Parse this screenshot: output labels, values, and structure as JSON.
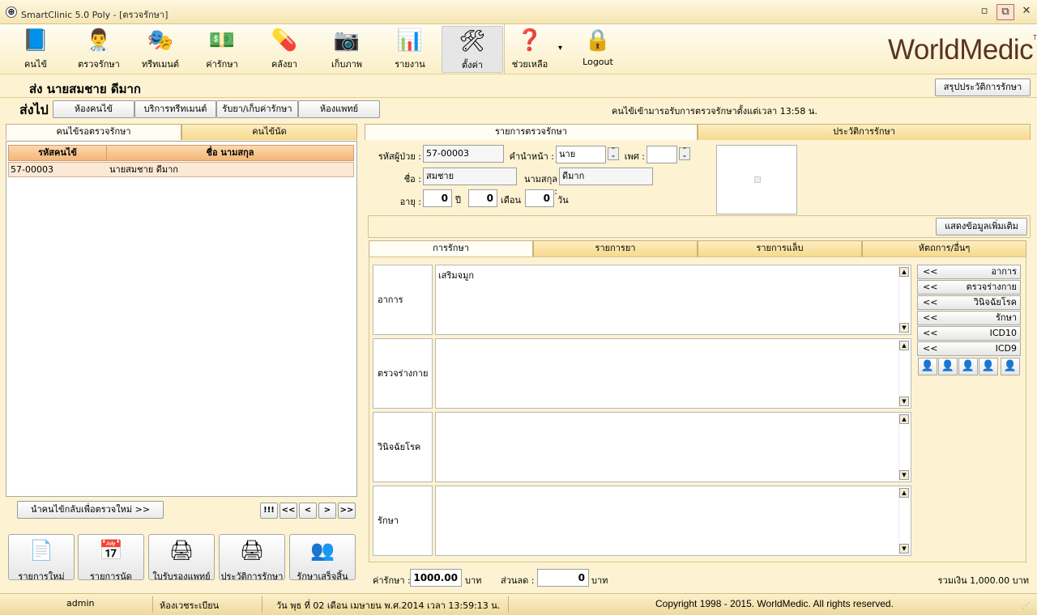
{
  "window": {
    "title": "SmartClinic 5.0 Poly - [ตรวจรักษา]",
    "app_icon": "⊕",
    "minimize_glyph": "▫",
    "restore_glyph": "⧉",
    "close_glyph": "✕"
  },
  "toolbar": {
    "items": [
      {
        "label": "คนไข้",
        "icon": "patient-book-icon",
        "glyph": "📘"
      },
      {
        "label": "ตรวจรักษา",
        "icon": "doctor-icon",
        "glyph": "👨‍⚕️"
      },
      {
        "label": "ทรีทเมนต์",
        "icon": "mask-icon",
        "glyph": "🎭"
      },
      {
        "label": "ค่ารักษา",
        "icon": "money-icon",
        "glyph": "💵"
      },
      {
        "label": "คลังยา",
        "icon": "pill-icon",
        "glyph": "💊"
      },
      {
        "label": "เก็บภาพ",
        "icon": "camera-icon",
        "glyph": "📷"
      },
      {
        "label": "รายงาน",
        "icon": "bar-chart-icon",
        "glyph": "📊"
      },
      {
        "label": "ตั้งค่า",
        "icon": "tools-icon",
        "glyph": "🛠"
      },
      {
        "label": "ช่วยเหลือ",
        "icon": "help-icon",
        "glyph": "❓"
      },
      {
        "label": "Logout",
        "icon": "lock-icon",
        "glyph": "🔒"
      }
    ],
    "help_dropdown": "▾",
    "brand": "WorldMedic",
    "brand_tm": "TM"
  },
  "patient_header": {
    "send_name": "ส่ง  นายสมชาย ดีมาก",
    "summary_button": "สรุปประวัติการรักษา"
  },
  "send_row": {
    "label": "ส่งไป",
    "buttons": [
      "ห้องคนไข้",
      "บริการทรีทเมนต์",
      "รับยา/เก็บค่ารักษา",
      "ห้องแพทย์"
    ],
    "info": "คนไข้เข้ามารอรับการตรวจรักษาตั้งแต่เวลา  13:58 น."
  },
  "left": {
    "tabs": [
      "คนไข้รอตรวจรักษา",
      "คนไข้นัด"
    ],
    "columns": [
      "รหัสคนไข้",
      "ชื่อ นามสกุล"
    ],
    "rows": [
      {
        "id": "57-00003",
        "name": "นายสมชาย ดีมาก"
      }
    ],
    "return_button": "นำคนไข้กลับเพื่อตรวจใหม่ >>",
    "nav": [
      "!!!",
      "<<",
      "<",
      ">",
      ">>"
    ],
    "bottom_buttons": [
      {
        "label": "รายการใหม่",
        "icon": "new-document-icon",
        "glyph": "📄"
      },
      {
        "label": "รายการนัด",
        "icon": "calendar-icon",
        "glyph": "📅"
      },
      {
        "label": "ใบรับรองแพทย์",
        "icon": "printer-icon",
        "glyph": "🖨"
      },
      {
        "label": "ประวัติการรักษา",
        "icon": "printer-check-icon",
        "glyph": "🖨"
      },
      {
        "label": "รักษาเสร็จสิ้น",
        "icon": "users-check-icon",
        "glyph": "👥"
      }
    ]
  },
  "right": {
    "top_tabs": [
      "รายการตรวจรักษา",
      "ประวัติการรักษา"
    ],
    "patient": {
      "id_label": "รหัสผู้ป่วย :",
      "id": "57-00003",
      "prefix_label": "คำนำหน้า :",
      "prefix": "นาย",
      "sex_label": "เพศ :",
      "sex": "",
      "first_label": "ชื่อ :",
      "first": "สมชาย",
      "last_label": "นามสกุล :",
      "last": "ดีมาก",
      "age_label": "อายุ :",
      "years": "0",
      "years_unit": "ปี",
      "months": "0",
      "months_unit": "เดือน",
      "days": "0",
      "days_unit": "วัน"
    },
    "more_button": "แสดงข้อมูลเพิ่มเติม",
    "sub_tabs": [
      "การรักษา",
      "รายการยา",
      "รายการแล็บ",
      "หัตถการ/อื่นๆ"
    ],
    "sections": [
      {
        "label": "อาการ",
        "text": "เสริมจมูก"
      },
      {
        "label": "ตรวจร่างกาย",
        "text": ""
      },
      {
        "label": "วินิจฉัยโรค",
        "text": ""
      },
      {
        "label": "รักษา",
        "text": ""
      }
    ],
    "side_buttons": [
      "อาการ",
      "ตรวจร่างกาย",
      "วินิจฉัยโรค",
      "รักษา",
      "ICD10",
      "ICD9"
    ],
    "side_arrow": "<<",
    "fee_label": "ค่ารักษา :",
    "fee": "1000.00",
    "fee_unit": "บาท",
    "discount_label": "ส่วนลด :",
    "discount": "0",
    "discount_unit": "บาท",
    "total": "รวมเงิน 1,000.00 บาท"
  },
  "status": {
    "user": "admin",
    "room": "ห้องเวชระเบียน",
    "datetime": "วัน พุธ ที่ 02 เดือน เมษายน พ.ศ.2014 เวลา 13:59:13 น.",
    "copyright": "Copyright 1998 - 2015. WorldMedic. All rights reserved."
  }
}
